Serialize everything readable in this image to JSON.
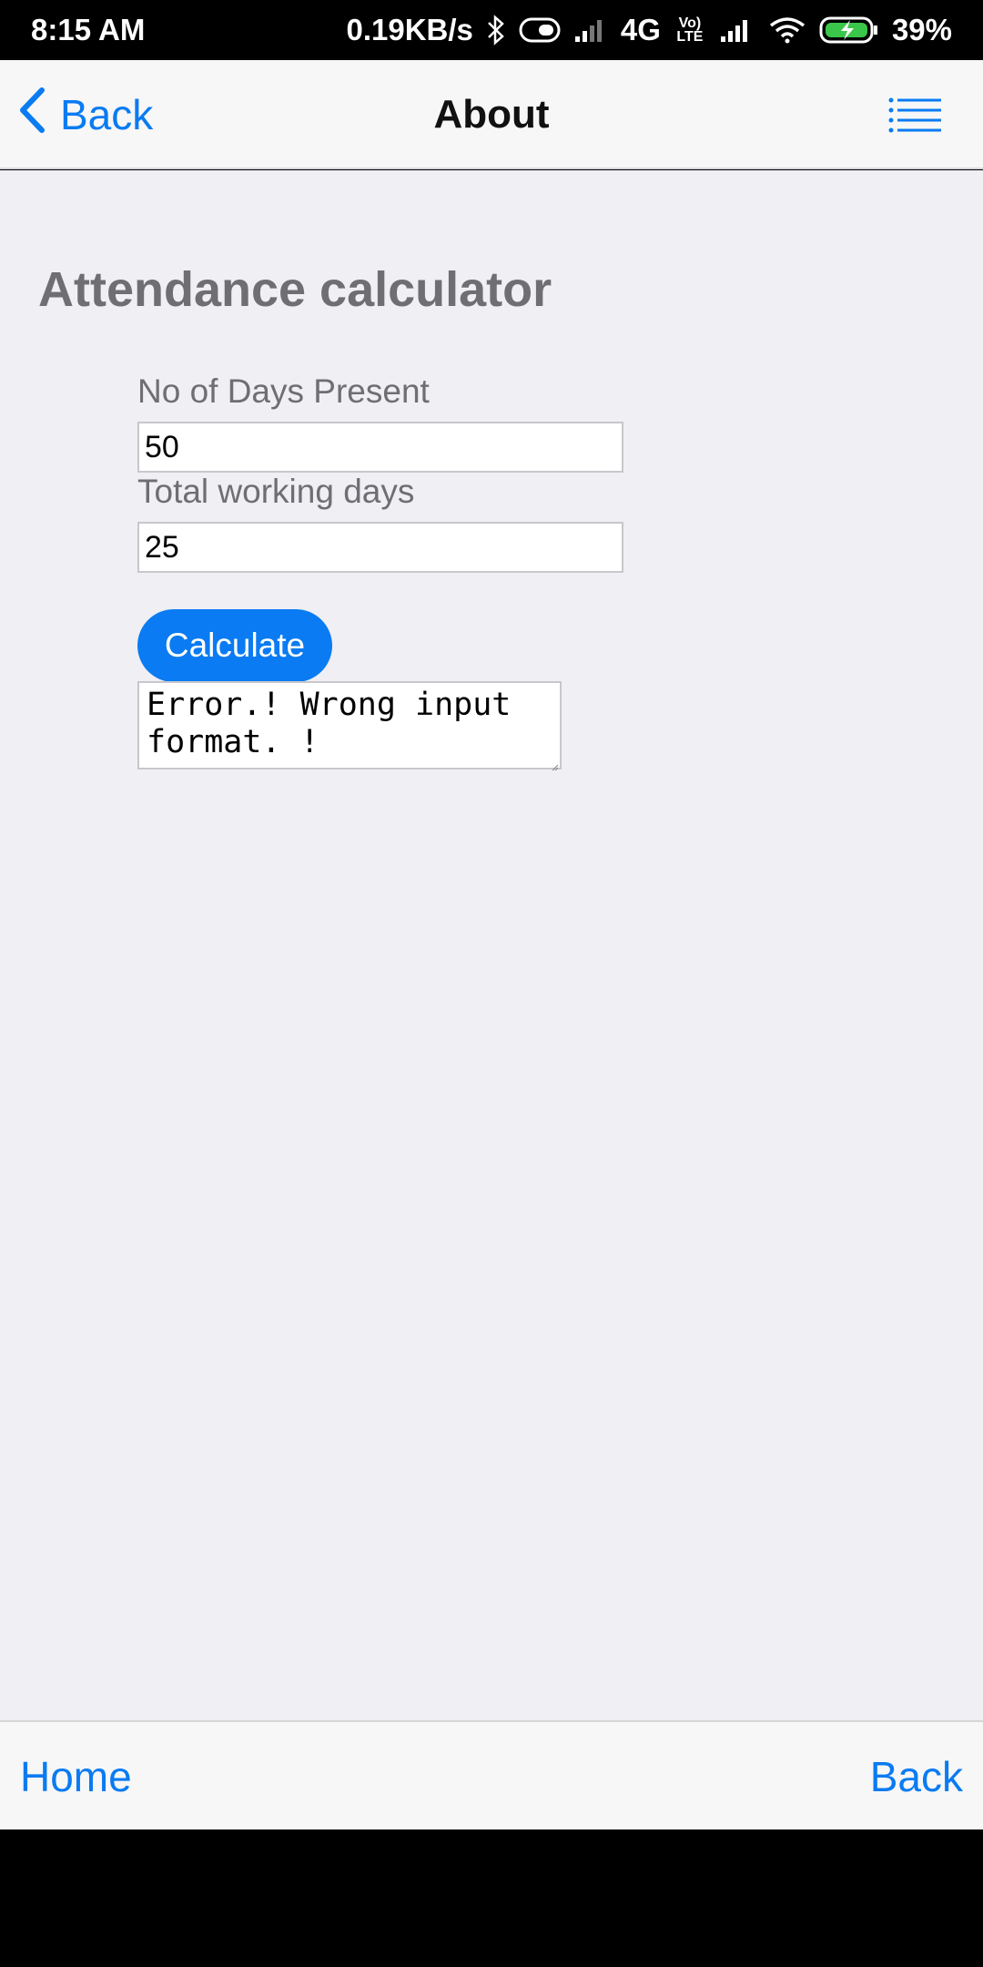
{
  "status_bar": {
    "time": "8:15 AM",
    "network_speed": "0.19KB/s",
    "network_type": "4G",
    "volte": "Vo) LTE",
    "battery": "39%",
    "icons": [
      "bluetooth-icon",
      "toggle-icon",
      "signal-icon",
      "volte-icon",
      "signal-icon",
      "wifi-icon",
      "battery-charging-icon"
    ]
  },
  "nav": {
    "back_label": "Back",
    "title": "About",
    "menu_icon": "list-menu-icon"
  },
  "main": {
    "heading": "Attendance calculator",
    "fields": [
      {
        "label": "No of Days Present",
        "value": "50"
      },
      {
        "label": "Total working days",
        "value": "25"
      }
    ],
    "calculate_label": "Calculate",
    "result": "Error.! Wrong input format. !"
  },
  "bottom_bar": {
    "home_label": "Home",
    "back_label": "Back"
  },
  "colors": {
    "accent": "#0a7bf2",
    "background": "#efeff4",
    "heading": "#6e6e73"
  }
}
